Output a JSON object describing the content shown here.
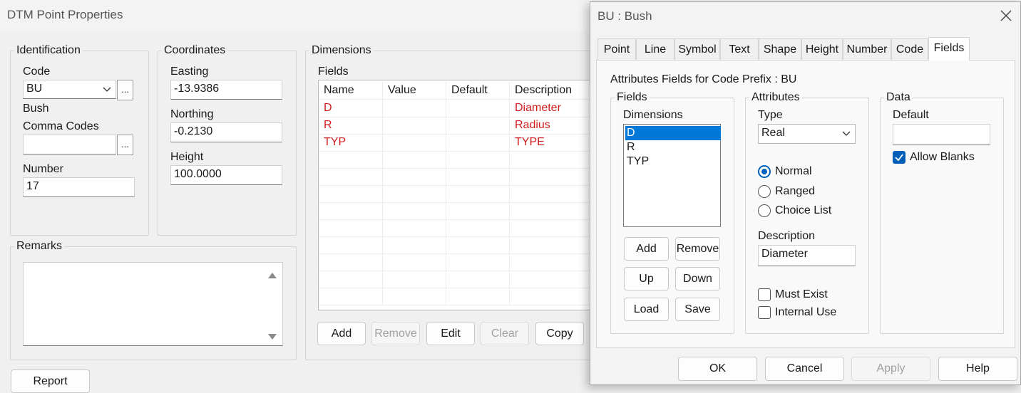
{
  "main": {
    "title": "DTM Point Properties",
    "identification": {
      "label": "Identification",
      "code_label": "Code",
      "code_value": "BU",
      "code_description": "Bush",
      "comma_codes_label": "Comma Codes",
      "comma_codes_value": "",
      "number_label": "Number",
      "number_value": "17",
      "ellipsis": "..."
    },
    "coordinates": {
      "label": "Coordinates",
      "easting_label": "Easting",
      "easting_value": "-13.9386",
      "northing_label": "Northing",
      "northing_value": "-0.2130",
      "height_label": "Height",
      "height_value": "100.0000"
    },
    "remarks": {
      "label": "Remarks",
      "value": ""
    },
    "dimensions": {
      "label": "Dimensions",
      "fields_label": "Fields",
      "columns": [
        "Name",
        "Value",
        "Default",
        "Description"
      ],
      "rows": [
        {
          "name": "D",
          "value": "",
          "default": "",
          "description": "Diameter"
        },
        {
          "name": "R",
          "value": "",
          "default": "",
          "description": "Radius"
        },
        {
          "name": "TYP",
          "value": "",
          "default": "",
          "description": "TYPE"
        }
      ],
      "buttons": {
        "add": "Add",
        "remove": "Remove",
        "edit": "Edit",
        "clear": "Clear",
        "copy": "Copy"
      }
    },
    "report_button": "Report"
  },
  "dialog": {
    "title": "BU : Bush",
    "tabs": [
      "Point",
      "Line",
      "Symbol",
      "Text",
      "Shape",
      "Height",
      "Number",
      "Code",
      "Fields"
    ],
    "active_tab": "Fields",
    "heading": "Attributes Fields for Code Prefix : BU",
    "fields_group": {
      "label": "Fields",
      "list_label": "Dimensions",
      "items": [
        "D",
        "R",
        "TYP"
      ],
      "selected": "D",
      "buttons": {
        "add": "Add",
        "remove": "Remove",
        "up": "Up",
        "down": "Down",
        "load": "Load",
        "save": "Save"
      }
    },
    "attributes_group": {
      "label": "Attributes",
      "type_label": "Type",
      "type_value": "Real",
      "radio_normal": "Normal",
      "radio_ranged": "Ranged",
      "radio_choice": "Choice List",
      "selected_radio": "Normal",
      "description_label": "Description",
      "description_value": "Diameter",
      "must_exist": "Must Exist",
      "internal_use": "Internal Use"
    },
    "data_group": {
      "label": "Data",
      "default_label": "Default",
      "default_value": "",
      "allow_blanks": "Allow Blanks"
    },
    "buttons": {
      "ok": "OK",
      "cancel": "Cancel",
      "apply": "Apply",
      "help": "Help"
    },
    "colors": {
      "accent": "#005fb8",
      "selection": "#0078d7",
      "red_text": "#d21f1f"
    }
  }
}
